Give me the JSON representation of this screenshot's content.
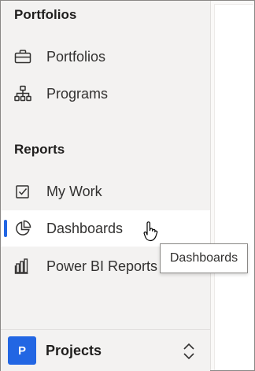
{
  "sidebar": {
    "sections": [
      {
        "header": "Portfolios",
        "items": [
          {
            "label": "Portfolios",
            "icon": "briefcase-icon"
          },
          {
            "label": "Programs",
            "icon": "org-chart-icon"
          }
        ]
      },
      {
        "header": "Reports",
        "items": [
          {
            "label": "My Work",
            "icon": "checkbox-icon"
          },
          {
            "label": "Dashboards",
            "icon": "pie-chart-icon",
            "active": true
          },
          {
            "label": "Power BI Reports",
            "icon": "power-bi-icon"
          }
        ]
      }
    ],
    "tooltip": "Dashboards",
    "footer": {
      "avatar_initial": "P",
      "title": "Projects",
      "icon": "chevron-up-down-icon"
    }
  },
  "colors": {
    "accent": "#2266e3",
    "sidebar_bg": "#f3f2f1",
    "active_bg": "#ffffff",
    "text": "#323130"
  }
}
